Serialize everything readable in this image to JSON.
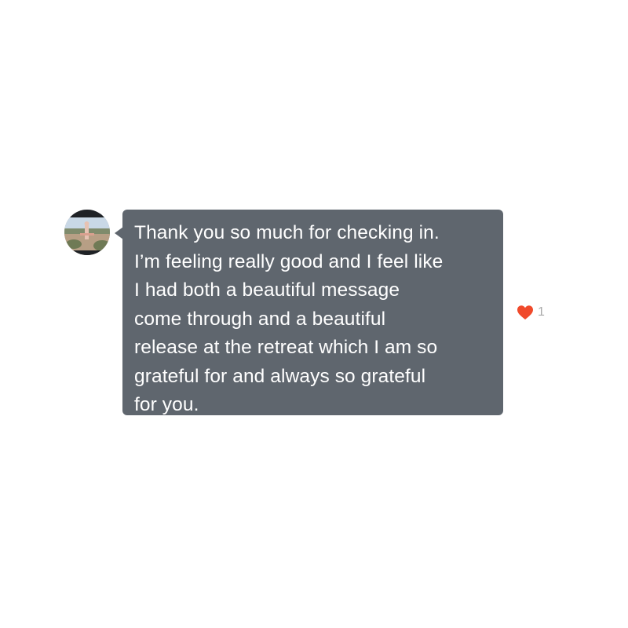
{
  "message": {
    "sender_avatar": "avatar-photo",
    "lines": [
      "Thank you so much for checking in.",
      "I’m feeling really good and I feel like",
      "I had both a beautiful message",
      "come through and a beautiful",
      "release at the retreat which I am so",
      "grateful for and always so grateful",
      "for you."
    ],
    "bubble_color": "#5f666e",
    "text_color": "#ffffff"
  },
  "reaction": {
    "icon": "heart-icon",
    "color": "#f04a2b",
    "count": "1"
  }
}
